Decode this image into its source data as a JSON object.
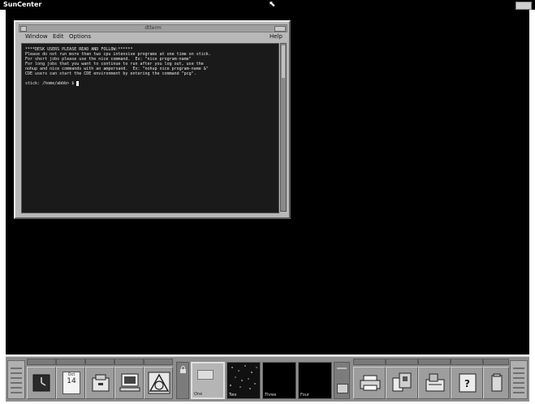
{
  "topbar": {
    "title": "SunCenter"
  },
  "terminal": {
    "title": "dtterm",
    "menu": {
      "window": "Window",
      "edit": "Edit",
      "options": "Options",
      "help": "Help"
    },
    "lines": [
      "****DESK USERS PLEASE READ AND FOLLOW:******",
      "Please do not run more than two cpu intensive programs at one time on stick.",
      "For short jobs please use the nice command.  Ex: \"nice program-name\"",
      "For long jobs that you want to continue to run after you log out, use the",
      "nohup and nice commands with an ampersand.  Ex: \"nohup nice program-name &\"",
      "CDE users can start the CDE environment by entering the command \"pcg\".",
      "",
      "stick: /home/abbb> $ "
    ]
  },
  "dock": {
    "calendar": {
      "month": "Oct",
      "day": "14"
    },
    "workspaces": [
      {
        "label": "One"
      },
      {
        "label": "Two"
      },
      {
        "label": "Three"
      },
      {
        "label": "Four"
      }
    ]
  },
  "colors": {
    "desktop": "#000000",
    "dock": "#8e8e8e",
    "terminal_bg": "#1a1a1a",
    "terminal_fg": "#e9e9e9"
  }
}
